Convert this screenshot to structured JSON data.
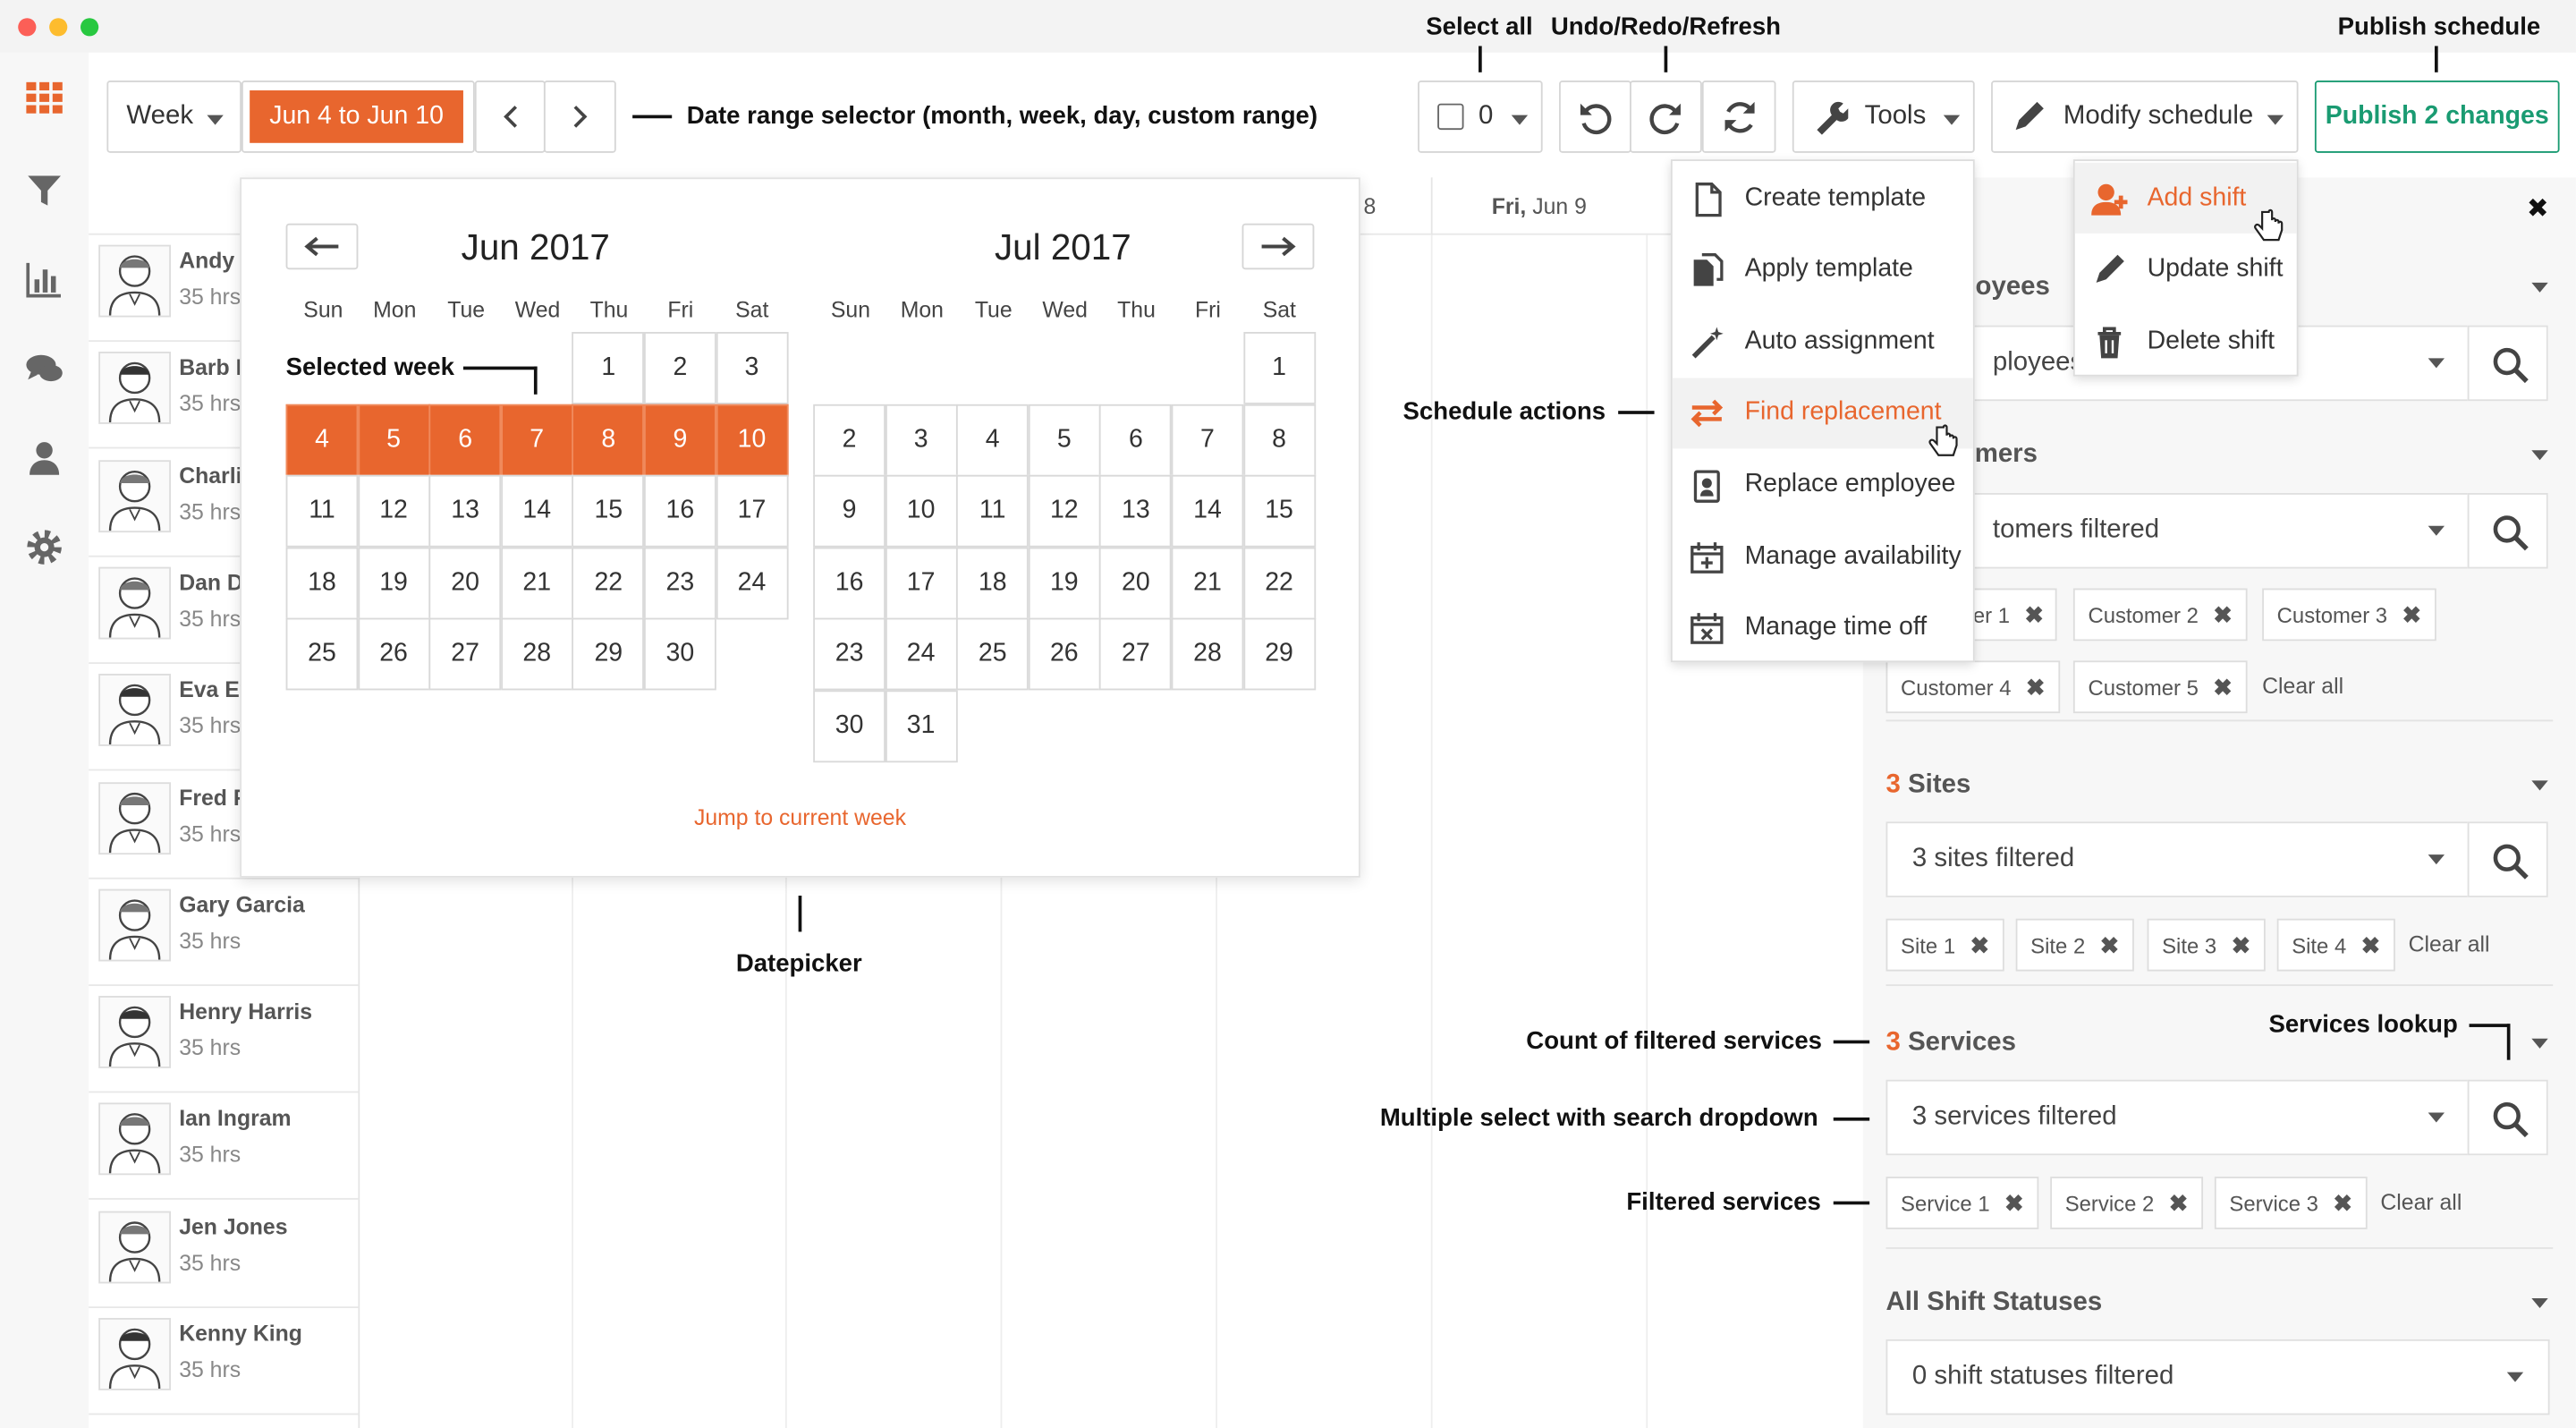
{
  "toolbar": {
    "view_label": "Week",
    "date_range": "Jun 4 to Jun 10",
    "select_count": "0",
    "tools_label": "Tools",
    "modify_label": "Modify schedule",
    "publish_label": "Publish 2 changes"
  },
  "annotations": {
    "select_all": "Select all",
    "undo_redo": "Undo/Redo/Refresh",
    "publish": "Publish schedule",
    "date_range": "Date range selector (month, week, day, custom range)",
    "selected_week": "Selected week",
    "schedule_actions": "Schedule actions",
    "datepicker": "Datepicker",
    "count_services": "Count of filtered services",
    "multi_select": "Multiple select with search dropdown",
    "filtered_services": "Filtered services",
    "services_lookup": "Services lookup"
  },
  "grid": {
    "header_day_partial": "8",
    "header_fri": "Fri,",
    "header_fri_date": "Jun 9"
  },
  "employees": [
    {
      "name": "Andy A",
      "hours": "35 hrs"
    },
    {
      "name": "Barb B",
      "hours": "35 hrs"
    },
    {
      "name": "Charli",
      "hours": "35 hrs"
    },
    {
      "name": "Dan D",
      "hours": "35 hrs"
    },
    {
      "name": "Eva Ev",
      "hours": "35 hrs"
    },
    {
      "name": "Fred F",
      "hours": "35 hrs"
    },
    {
      "name": "Gary Garcia",
      "hours": "35 hrs"
    },
    {
      "name": "Henry Harris",
      "hours": "35 hrs"
    },
    {
      "name": "Ian Ingram",
      "hours": "35 hrs"
    },
    {
      "name": "Jen Jones",
      "hours": "35 hrs"
    },
    {
      "name": "Kenny King",
      "hours": "35 hrs"
    }
  ],
  "datepicker": {
    "month1": "Jun 2017",
    "month2": "Jul 2017",
    "dow": [
      "Sun",
      "Mon",
      "Tue",
      "Wed",
      "Thu",
      "Fri",
      "Sat"
    ],
    "jun_weeks": [
      [
        "",
        "",
        "",
        "",
        "1",
        "2",
        "3"
      ],
      [
        "4",
        "5",
        "6",
        "7",
        "8",
        "9",
        "10"
      ],
      [
        "11",
        "12",
        "13",
        "14",
        "15",
        "16",
        "17"
      ],
      [
        "18",
        "19",
        "20",
        "21",
        "22",
        "23",
        "24"
      ],
      [
        "25",
        "26",
        "27",
        "28",
        "29",
        "30",
        ""
      ]
    ],
    "jul_weeks": [
      [
        "",
        "",
        "",
        "",
        "",
        "",
        "1"
      ],
      [
        "2",
        "3",
        "4",
        "5",
        "6",
        "7",
        "8"
      ],
      [
        "9",
        "10",
        "11",
        "12",
        "13",
        "14",
        "15"
      ],
      [
        "16",
        "17",
        "18",
        "19",
        "20",
        "21",
        "22"
      ],
      [
        "23",
        "24",
        "25",
        "26",
        "27",
        "28",
        "29"
      ],
      [
        "30",
        "31",
        "",
        "",
        "",
        "",
        ""
      ]
    ],
    "selected_week_index": 1,
    "jump_label": "Jump to current week"
  },
  "tools_menu": [
    {
      "label": "Create template",
      "icon": "file-icon"
    },
    {
      "label": "Apply template",
      "icon": "copy-file-icon"
    },
    {
      "label": "Auto assignment",
      "icon": "magic-wand-icon"
    },
    {
      "label": "Find replacement",
      "icon": "swap-arrows-icon",
      "active": true
    },
    {
      "label": "Replace employee",
      "icon": "id-badge-icon"
    },
    {
      "label": "Manage availability",
      "icon": "calendar-plus-icon"
    },
    {
      "label": "Manage time off",
      "icon": "calendar-x-icon"
    }
  ],
  "modify_menu": [
    {
      "label": "Add shift",
      "icon": "add-user-icon",
      "active": true
    },
    {
      "label": "Update shift",
      "icon": "pencil-icon"
    },
    {
      "label": "Delete shift",
      "icon": "trash-icon"
    }
  ],
  "filters": {
    "employees": {
      "title_partial": "loyees",
      "field_partial": "ployees f"
    },
    "customers": {
      "title_partial": "mers",
      "field_partial": "tomers filtered",
      "chips": [
        "er 1",
        "Customer 2",
        "Customer 3",
        "Customer 4",
        "Customer 5"
      ],
      "clear": "Clear all"
    },
    "sites": {
      "count": "3",
      "title": "Sites",
      "field": "3 sites filtered",
      "chips": [
        "Site 1",
        "Site 2",
        "Site 3",
        "Site 4"
      ],
      "clear": "Clear all"
    },
    "services": {
      "count": "3",
      "title": "Services",
      "field": "3 services filtered",
      "chips": [
        "Service 1",
        "Service 2",
        "Service 3"
      ],
      "clear": "Clear all"
    },
    "statuses": {
      "title": "All Shift Statuses",
      "field": "0 shift statuses filtered"
    },
    "close": "✖"
  },
  "colors": {
    "accent": "#e8662e",
    "publish": "#1a9b72"
  }
}
